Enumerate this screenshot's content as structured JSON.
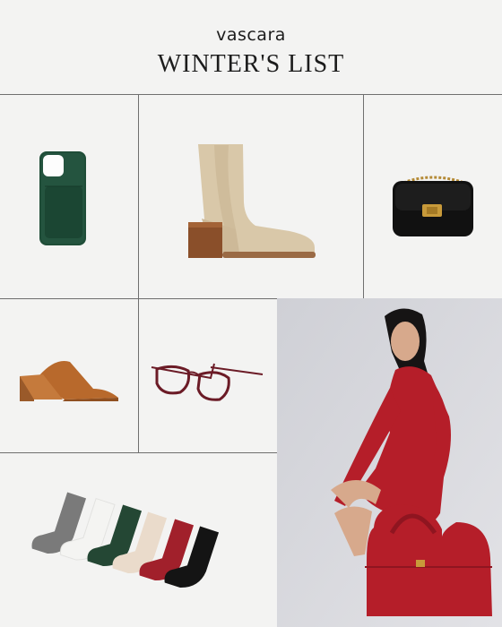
{
  "header": {
    "brand": "vascara",
    "title": "WINTER'S LIST"
  },
  "products": [
    {
      "name": "green phone case",
      "color": "#1f4d38"
    },
    {
      "name": "beige chelsea boot",
      "color": "#d8c7a8"
    },
    {
      "name": "black chain bag",
      "color": "#111111"
    },
    {
      "name": "tan suede mule",
      "color": "#b8692c"
    },
    {
      "name": "burgundy eyeglasses",
      "color": "#6b1b26"
    },
    {
      "name": "socks set",
      "colors": [
        "#7a7a7a",
        "#f4f4f2",
        "#244734",
        "#eadbcb",
        "#a1202b",
        "#141414"
      ]
    },
    {
      "name": "model with red dress and red dome bag",
      "color": "#b51e29"
    }
  ]
}
